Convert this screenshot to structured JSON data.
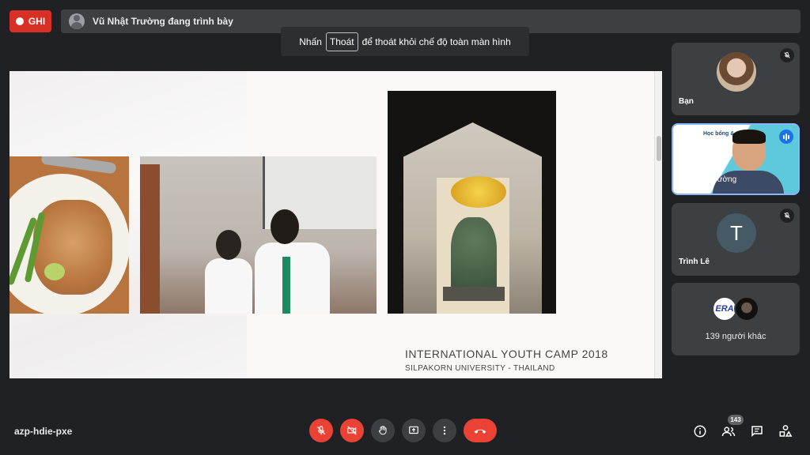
{
  "recording": {
    "label": "GHI",
    "color": "#d93025"
  },
  "presenter": {
    "text": "Vũ Nhật Trường đang trình bày",
    "icon": "presenter-avatar-icon"
  },
  "fullscreen_toast": {
    "prefix": "Nhấn",
    "key": "Thoát",
    "suffix": "để thoát khỏi chế độ toàn màn hình"
  },
  "slide": {
    "title": "INTERNATIONAL YOUTH CAMP 2018",
    "subtitle": "SILPAKORN UNIVERSITY - THAILAND",
    "photos": [
      "pad-thai-photo",
      "students-photo",
      "ganesha-shrine-photo"
    ]
  },
  "participants": [
    {
      "name": "Bạn",
      "muted": true,
      "avatar": "photo"
    },
    {
      "name": "Vũ Nhật Trường",
      "speaking": true,
      "video_heading": "Học bổng & cơ hội học"
    },
    {
      "name": "Trình Lê",
      "muted": true,
      "avatar_letter": "T"
    },
    {
      "others_label": "139 người khác",
      "badge_text": "ERA"
    }
  ],
  "bottom_bar": {
    "meeting_code": "azp-hdie-pxe",
    "people_count": "143",
    "controls": [
      "mic-off-icon",
      "camera-off-icon",
      "raise-hand-icon",
      "present-screen-icon",
      "more-options-icon",
      "end-call-icon"
    ],
    "right_icons": [
      "info-icon",
      "people-icon",
      "chat-icon",
      "activities-icon"
    ]
  },
  "colors": {
    "accent": "#8ab4f8",
    "danger": "#ea4335",
    "surface": "#3c4043",
    "background": "#202124"
  }
}
